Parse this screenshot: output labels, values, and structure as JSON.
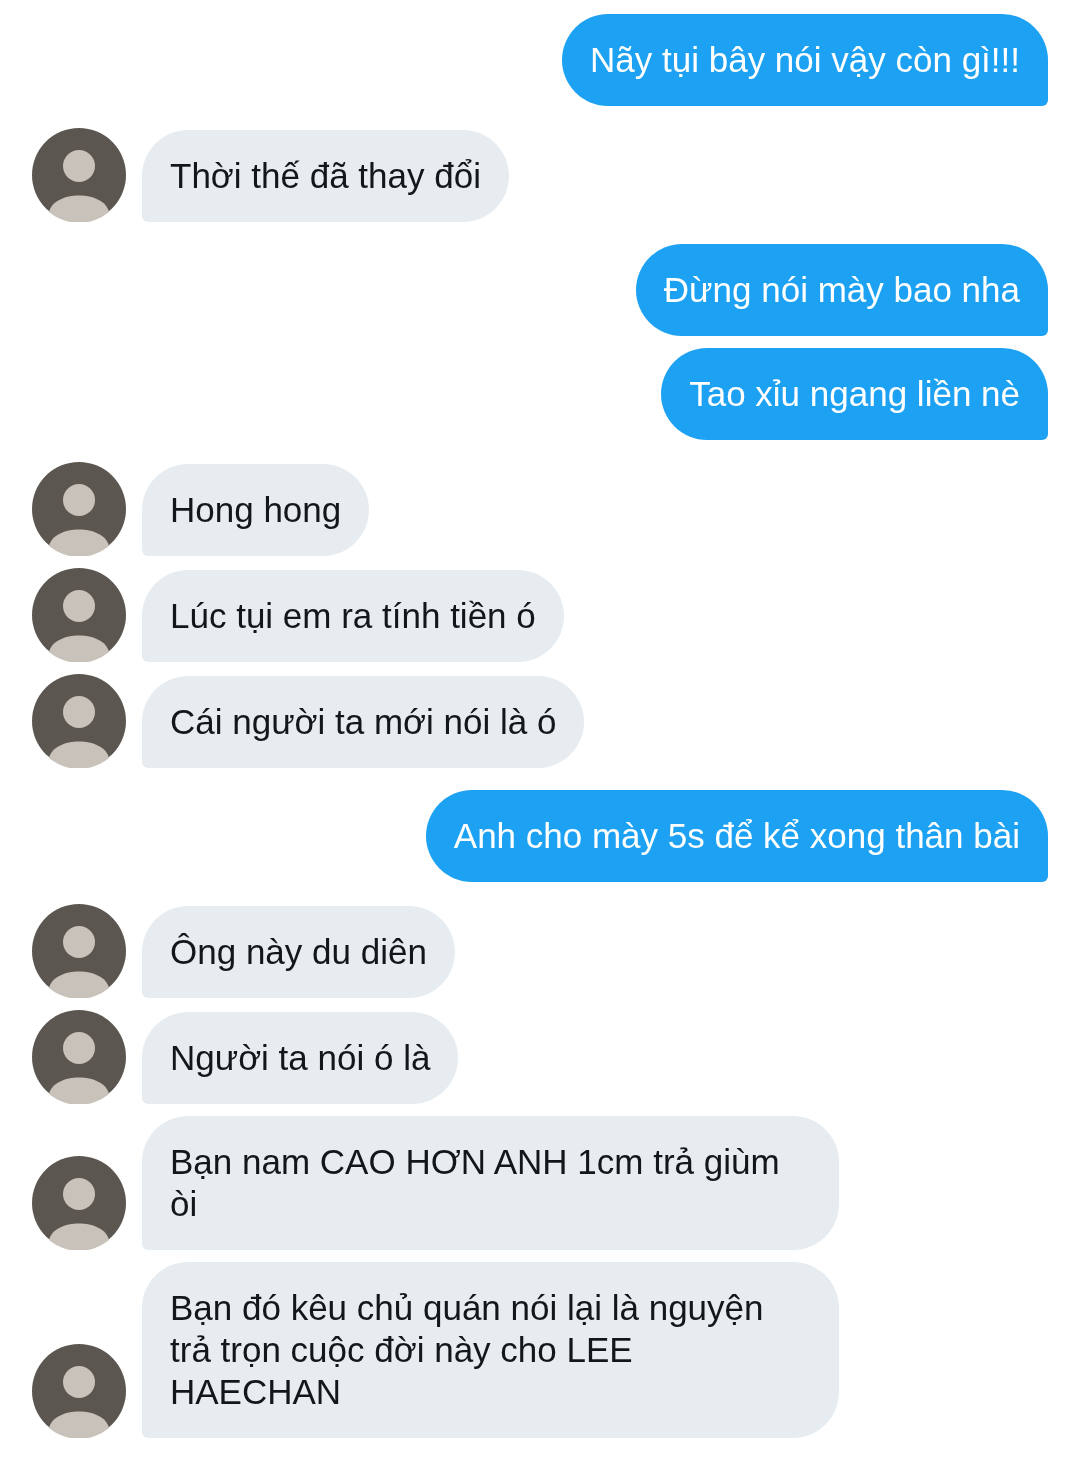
{
  "messages": [
    {
      "kind": "sent",
      "text": "Nãy tụi bây nói vậy còn gì!!!"
    },
    {
      "kind": "received",
      "text": "Thời thế đã thay đổi"
    },
    {
      "kind": "sent",
      "text": "Đừng nói mày bao nha"
    },
    {
      "kind": "sent",
      "text": "Tao xỉu ngang liền nè"
    },
    {
      "kind": "received",
      "text": "Hong hong"
    },
    {
      "kind": "received",
      "text": "Lúc tụi em ra tính tiền ó"
    },
    {
      "kind": "received",
      "text": "Cái người ta mới nói là ó"
    },
    {
      "kind": "sent",
      "text": "Anh cho mày 5s để kể xong thân bài"
    },
    {
      "kind": "received",
      "text": "Ông này du diên"
    },
    {
      "kind": "received",
      "text": "Người ta nói ó là"
    },
    {
      "kind": "received",
      "text": "Bạn nam CAO HƠN ANH 1cm trả giùm òi"
    },
    {
      "kind": "received",
      "text": "Bạn đó kêu chủ quán nói lại là nguyện trả trọn cuộc đời này cho LEE HAECHAN"
    }
  ]
}
